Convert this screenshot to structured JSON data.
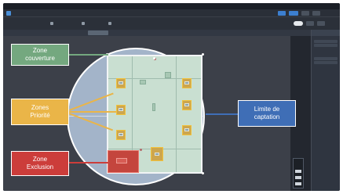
{
  "window": {
    "title": "",
    "app_name": ""
  },
  "callouts": {
    "coverage": "Zone\ncouverture",
    "priority": "Zones\nPriorité",
    "exclusion": "Zone\nExclusion",
    "capture_limit": "Limite de\ncaptation"
  },
  "colors": {
    "coverage": "#74a87f",
    "priority": "#eab548",
    "exclusion": "#cc3d3a",
    "capture_limit": "#3f6eb6",
    "background": "#23272f",
    "capture_area": "#a3b4c9"
  },
  "icons": [
    "app-icon",
    "tool-icon"
  ]
}
